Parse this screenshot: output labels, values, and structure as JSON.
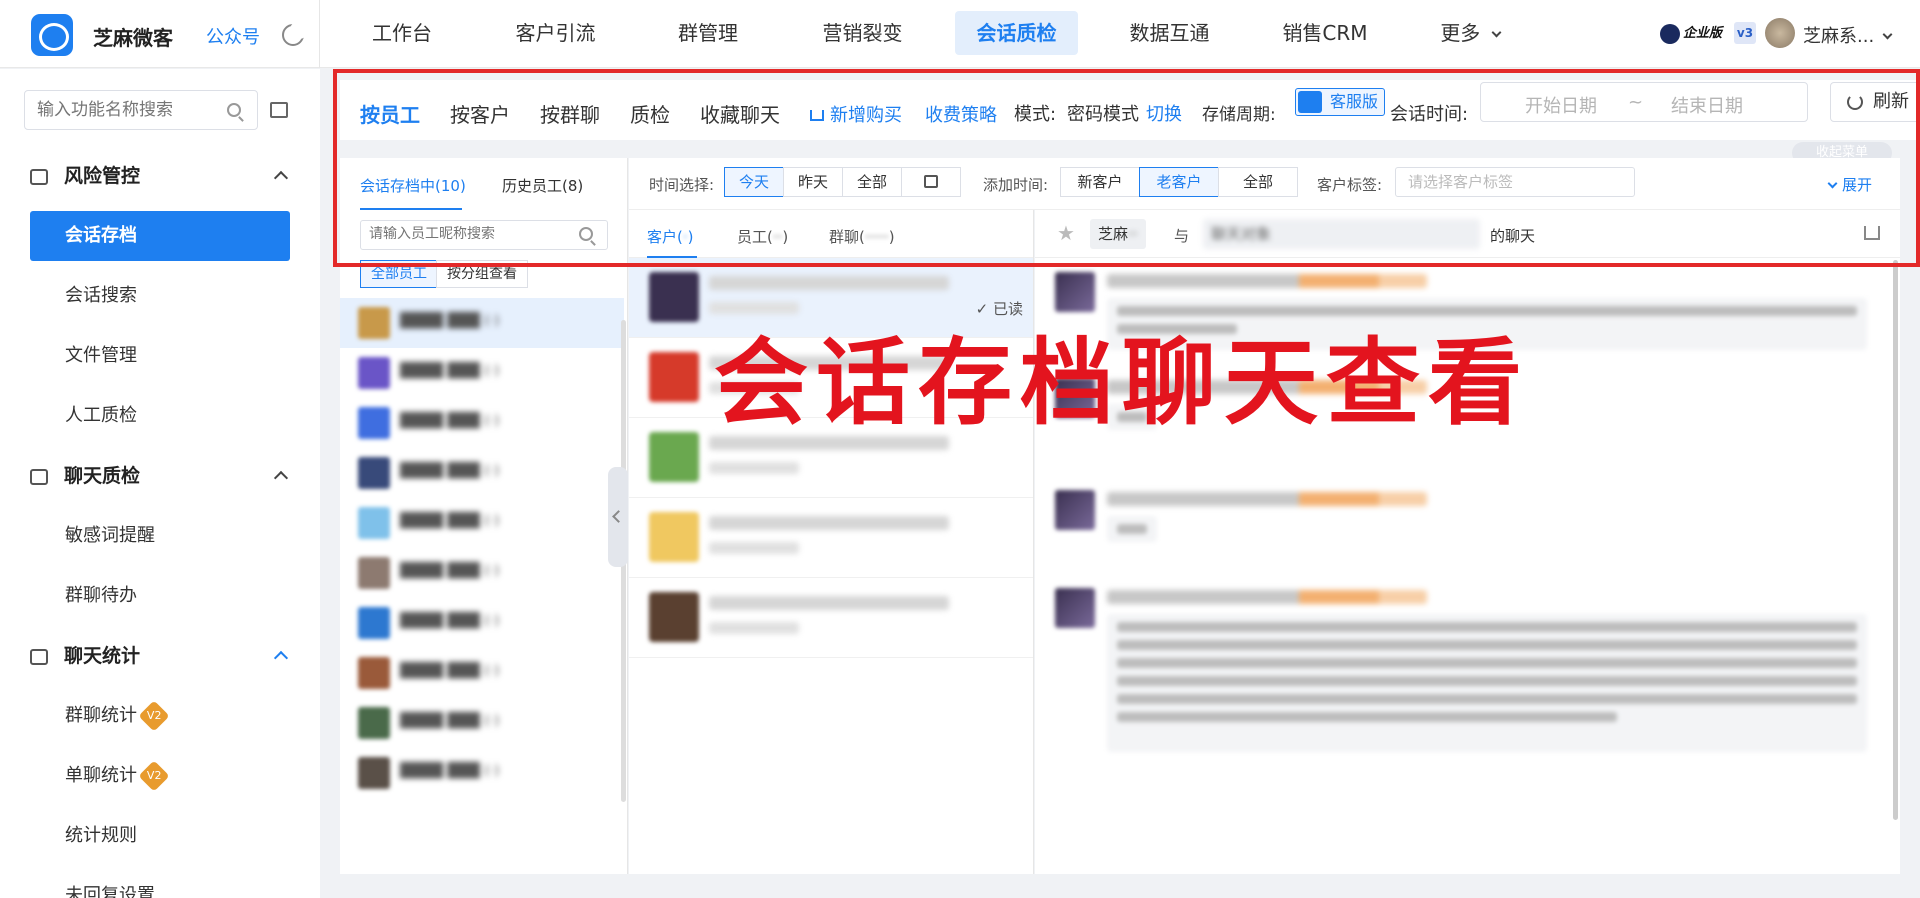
{
  "brand": {
    "name": "芝麻微客",
    "gzh": "公众号"
  },
  "nav": [
    "工作台",
    "客户引流",
    "群管理",
    "营销裂变",
    "会话质检",
    "数据互通",
    "销售CRM",
    "更多"
  ],
  "nav_active": "会话质检",
  "user": {
    "edition": "企业版",
    "version": "v3",
    "name": "芝麻系..."
  },
  "sidebar": {
    "search_placeholder": "输入功能名称搜索",
    "groups": [
      {
        "title": "风险管控",
        "items": [
          "会话存档",
          "会话搜索",
          "文件管理",
          "人工质检"
        ]
      },
      {
        "title": "聊天质检",
        "items": [
          "敏感词提醒",
          "群聊待办"
        ]
      },
      {
        "title": "聊天统计",
        "items": [
          "群聊统计",
          "单聊统计",
          "统计规则",
          "未回复设置"
        ]
      }
    ],
    "badge": "V2",
    "active_item": "会话存档"
  },
  "toolbar": {
    "tabs": [
      "按员工",
      "按客户",
      "按群聊",
      "质检",
      "收藏聊天"
    ],
    "buy": "新增购买",
    "fee": "收费策略",
    "mode_label": "模式:",
    "mode_value": "密码模式",
    "switch": "切换",
    "storage_label": "存储周期:",
    "storage_value": "客服版",
    "time_label": "会话时间:",
    "start_placeholder": "开始日期",
    "sep": "~",
    "end_placeholder": "结束日期",
    "refresh": "刷新",
    "collapse": "收起菜单"
  },
  "employee": {
    "tab_active": "会话存档中(10)",
    "tab_history": "历史员工(8)",
    "search_placeholder": "请输入员工昵称搜索",
    "all": "全部员工",
    "by_group": "按分组查看",
    "avatar_colors": [
      "#c8994a",
      "#6a55c7",
      "#3f6ee0",
      "#384a7a",
      "#7fc1ea",
      "#8d7a70",
      "#2d78d0",
      "#9a5a3a",
      "#4a6a4a",
      "#5a5048"
    ]
  },
  "filters": {
    "time_label": "时间选择:",
    "time_options": [
      "今天",
      "昨天",
      "全部"
    ],
    "add_label": "添加时间:",
    "add_options": [
      "新客户",
      "老客户",
      "全部"
    ],
    "tag_label": "客户标签:",
    "tag_placeholder": "请选择客户标签",
    "expand": "展开"
  },
  "conversations": {
    "tabs": [
      "客户(",
      "员工(",
      "群聊("
    ],
    "read_label": "已读",
    "avatar_colors": [
      "#3a3050",
      "#d63a2a",
      "#6aa84f",
      "#f0c860",
      "#5a4030"
    ]
  },
  "chat": {
    "name_a": "芝麻",
    "with": "与",
    "name_b": "聊天对象",
    "suffix": "的聊天"
  },
  "overlay_text": "会话存档聊天查看"
}
